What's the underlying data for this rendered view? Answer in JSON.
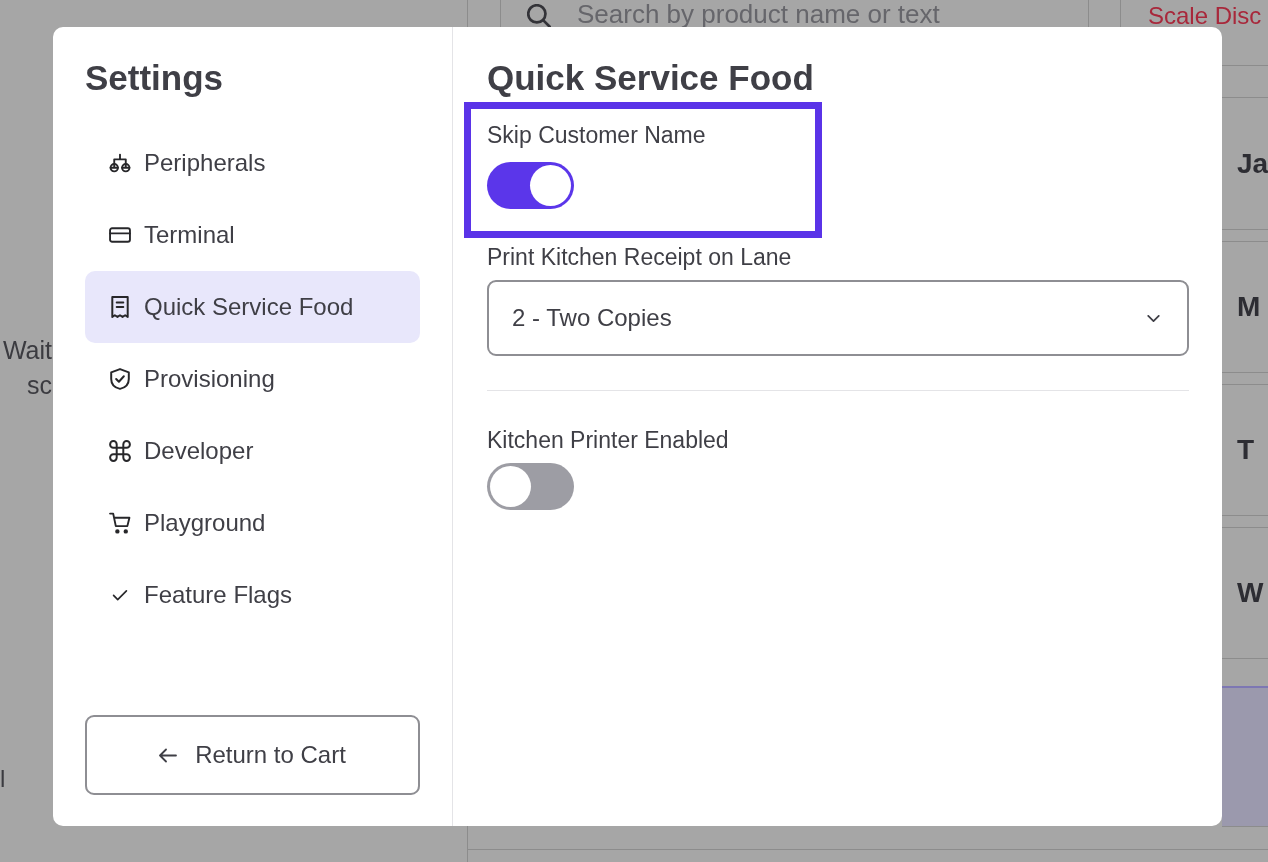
{
  "background": {
    "search": {
      "placeholder": "Search by product name or text"
    },
    "scale_button": {
      "label": "Scale Disc"
    },
    "status_lines": [
      "Wait",
      "sc"
    ],
    "fragment": "l",
    "tiles": [
      {
        "label": "Ja"
      },
      {
        "label": "M"
      },
      {
        "label": "T"
      },
      {
        "label": "W"
      }
    ]
  },
  "settings": {
    "title": "Settings",
    "items": [
      {
        "label": "Peripherals",
        "selected": false
      },
      {
        "label": "Terminal",
        "selected": false
      },
      {
        "label": "Quick Service Food",
        "selected": true
      },
      {
        "label": "Provisioning",
        "selected": false
      },
      {
        "label": "Developer",
        "selected": false
      },
      {
        "label": "Playground",
        "selected": false
      },
      {
        "label": "Feature Flags",
        "selected": false
      }
    ],
    "return_button": {
      "label": "Return to Cart"
    }
  },
  "panel": {
    "title": "Quick Service Food",
    "fields": [
      {
        "kind": "toggle",
        "label": "Skip Customer Name",
        "on": true,
        "highlighted": true
      },
      {
        "kind": "select",
        "label": "Print Kitchen Receipt on Lane",
        "value": "2 - Two Copies",
        "highlighted": false
      },
      {
        "kind": "divider"
      },
      {
        "kind": "toggle",
        "label": "Kitchen Printer Enabled",
        "on": false,
        "highlighted": false
      }
    ]
  }
}
